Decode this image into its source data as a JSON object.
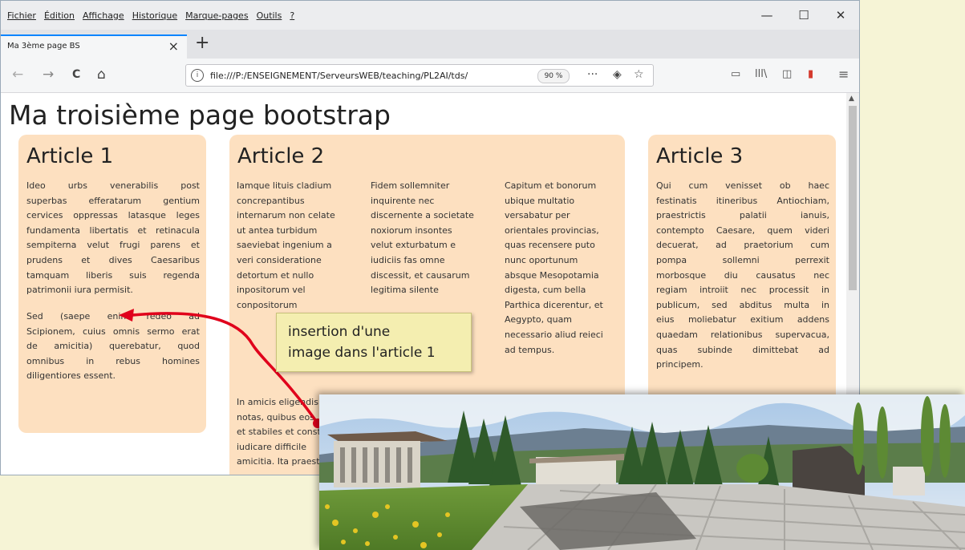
{
  "menu": [
    "Fichier",
    "Édition",
    "Affichage",
    "Historique",
    "Marque-pages",
    "Outils",
    "?"
  ],
  "window_controls": {
    "minimize": "—",
    "maximize": "☐",
    "close": "✕"
  },
  "tab": {
    "title": "Ma 3ème page BS",
    "close": "×",
    "new_tab": "+"
  },
  "nav": {
    "back": "←",
    "forward": "→",
    "reload": "C",
    "home": "⌂",
    "info": "i",
    "url": "file:///P:/ENSEIGNEMENT/ServeursWEB/teaching/PL2AI/tds/",
    "zoom": "90 %",
    "more": "···",
    "pocket": "◈",
    "bookmark": "☆",
    "reader": "▭",
    "library": "lll\\",
    "sidebar": "◫",
    "extension": "▮",
    "menu": "≡"
  },
  "page": {
    "title": "Ma troisième page bootstrap",
    "article1": {
      "heading": "Article 1",
      "p1_lines": [
        "Ideo urbs venerabilis post",
        "superbas efferatarum gentium",
        "cervices oppressas latasque leges",
        "fundamenta libertatis et retinacula",
        "sempiterna velut frugi parens et",
        "prudens et dives Caesaribus",
        "tamquam liberis suis regenda",
        "patrimonii iura permisit."
      ],
      "p2_lines": [
        "Sed (saepe enim redeo ad",
        "Scipionem, cuius omnis sermo erat",
        "de amicitia) querebatur, quod",
        "omnibus in rebus homines",
        "diligentiores essent."
      ]
    },
    "article2": {
      "heading": "Article 2",
      "col1_lines": [
        "Iamque lituis cladium",
        "concrepantibus",
        "internarum non celate",
        "ut antea turbidum",
        "saeviebat ingenium a",
        "veri consideratione",
        "detortum et nullo",
        "inpositorum vel",
        "conpositorum"
      ],
      "col2_lines": [
        "Fidem sollemniter",
        "inquirente nec",
        "discernente a societate",
        "noxiorum insontes",
        "velut exturbatum e",
        "iudiciis fas omne",
        "discessit, et causarum",
        "legitima silente"
      ],
      "col3_lines": [
        "Capitum et bonorum",
        "ubique multatio",
        "versabatur per",
        "orientales provincias,",
        "quas recensere puto",
        "nunc oportunum",
        "absque Mesopotamia",
        "digesta, cum bella",
        "Parthica dicerentur, et",
        "Aegypto, quam",
        "necessario aliud reieci",
        "ad tempus."
      ],
      "bottom_lines": [
        "In amicis eligendis",
        "notas, quibus eos",
        "et stabiles et constantes",
        "iudicare difficile",
        "amicitia. Ita praestare"
      ]
    },
    "article3": {
      "heading": "Article 3",
      "lines": [
        "Qui cum venisset ob haec",
        "festinatis itineribus Antiochiam,",
        "praestrictis palatii ianuis,",
        "contempto Caesare, quem videri",
        "decuerat, ad praetorium cum",
        "pompa sollemni perrexit",
        "morbosque diu causatus nec",
        "regiam introiit nec processit in",
        "publicum, sed abditus multa in",
        "eius moliebatur exitium addens",
        "quaedam relationibus supervacua,",
        "quas subinde dimittebat ad",
        "principem."
      ]
    }
  },
  "annotation": {
    "lines": [
      "insertion d'une",
      "image dans l'article 1"
    ]
  },
  "colors": {
    "article_bg": "#fde0c0",
    "callout_bg": "#f4eeb0",
    "arrow": "#e0001b",
    "tab_accent": "#0a84ff",
    "slide_bg": "#f6f4d6"
  }
}
